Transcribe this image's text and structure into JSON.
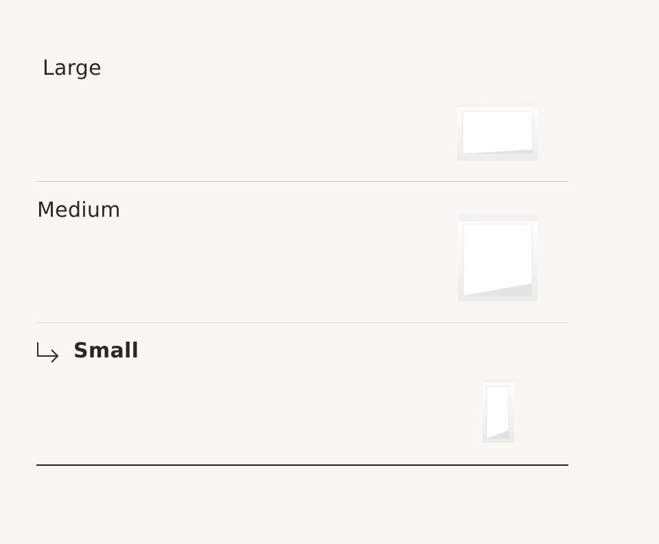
{
  "size_options": [
    {
      "label": "Large",
      "selected": false,
      "image_icon": "shelf-large-icon"
    },
    {
      "label": "Medium",
      "selected": false,
      "image_icon": "shelf-medium-icon"
    },
    {
      "label": "Small",
      "selected": true,
      "image_icon": "shelf-small-icon"
    }
  ],
  "selected_indicator_icon": "arrow-down-right-icon",
  "colors": {
    "background": "#f8f7f3",
    "text": "#2a2826",
    "divider": "#c6c4bf",
    "active_divider": "#222222",
    "shelf": "#ffffff"
  }
}
